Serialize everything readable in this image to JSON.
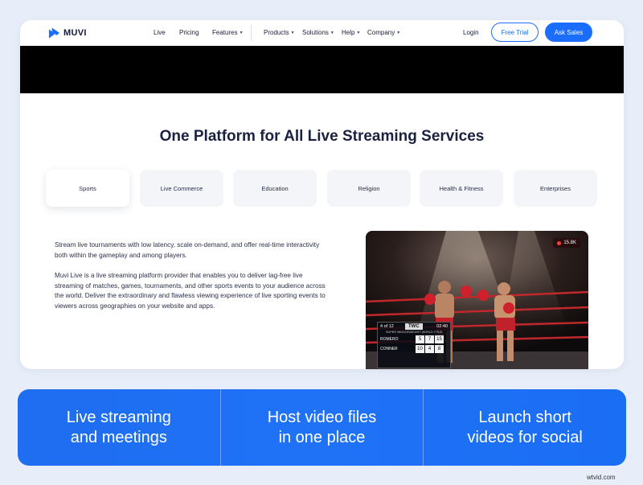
{
  "brand": {
    "name": "MUVI",
    "accent": "#1a6dff"
  },
  "nav": {
    "links": [
      {
        "label": "Live"
      },
      {
        "label": "Pricing"
      },
      {
        "label": "Features"
      },
      {
        "label": "Products"
      },
      {
        "label": "Solutions"
      },
      {
        "label": "Help"
      },
      {
        "label": "Company"
      }
    ],
    "login": "Login",
    "free_trial": "Free Trial",
    "ask_sales": "Ask Sales"
  },
  "section": {
    "title": "One Platform for All Live Streaming Services",
    "tabs": [
      {
        "label": "Sports",
        "active": true
      },
      {
        "label": "Live Commerce"
      },
      {
        "label": "Education"
      },
      {
        "label": "Religion"
      },
      {
        "label": "Health & Fitness"
      },
      {
        "label": "Enterprises"
      }
    ],
    "lead": "Stream live tournaments with low latency, scale on-demand, and offer real-time interactivity both within the gameplay and among players.",
    "body": "Muvi Live is a live streaming platform provider that enables you to deliver lag-free live streaming of matches, games, tournaments, and other sports events to your audience across the world. Deliver the extraordinary and flawless viewing experience of live sporting events to viewers across geographies on your website and apps."
  },
  "hero": {
    "viewers": "15.8K",
    "scoreboard": {
      "round": "4 of 12",
      "logo": "TWC",
      "clock": "02:40",
      "title": "SUPER MIDDLEWEIGHT WORLD TITLE",
      "rows": [
        {
          "name": "ROMERO",
          "scores": [
            "5",
            "7",
            "15"
          ]
        },
        {
          "name": "CONNER",
          "scores": [
            "10",
            "4",
            "8"
          ]
        }
      ]
    }
  },
  "banner": {
    "items": [
      {
        "line1": "Live streaming",
        "line2": "and meetings"
      },
      {
        "line1": "Host video files",
        "line2": "in one place"
      },
      {
        "line1": "Launch short",
        "line2": "videos for social"
      }
    ]
  },
  "watermark": "wtvid.com"
}
